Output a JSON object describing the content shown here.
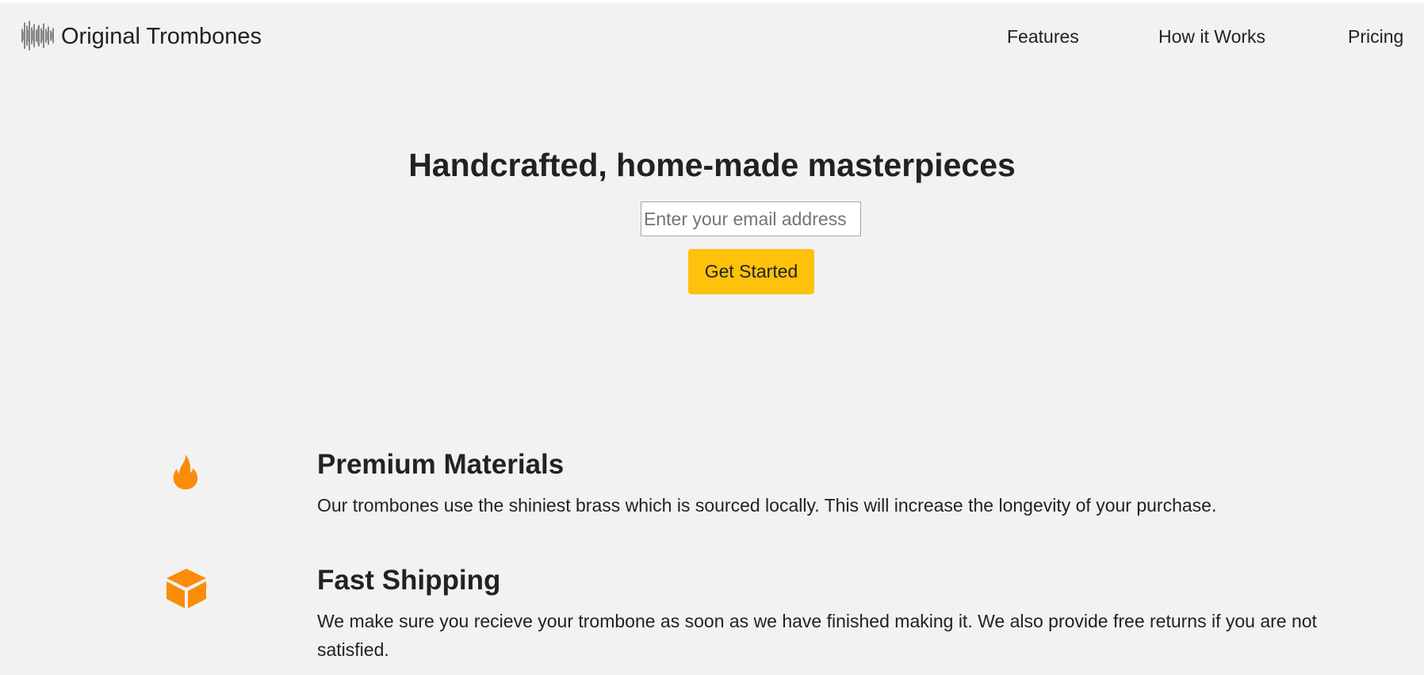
{
  "header": {
    "brand": "Original Trombones",
    "logo_icon": "sound-wave-logo-icon",
    "nav": [
      {
        "label": "Features"
      },
      {
        "label": "How it Works"
      },
      {
        "label": "Pricing"
      }
    ]
  },
  "hero": {
    "title": "Handcrafted, home-made masterpieces",
    "email_placeholder": "Enter your email address",
    "email_value": "",
    "cta_label": "Get Started"
  },
  "features": [
    {
      "icon": "fire-icon",
      "title": "Premium Materials",
      "description": "Our trombones use the shiniest brass which is sourced locally. This will increase the longevity of your purchase."
    },
    {
      "icon": "box-icon",
      "title": "Fast Shipping",
      "description": "We make sure you recieve your trombone as soon as we have finished making it. We also provide free returns if you are not satisfied."
    }
  ],
  "colors": {
    "page_background": "#f2f2f2",
    "accent_button": "#fdc209",
    "icon_orange": "#fb8c09",
    "text": "#222222"
  }
}
